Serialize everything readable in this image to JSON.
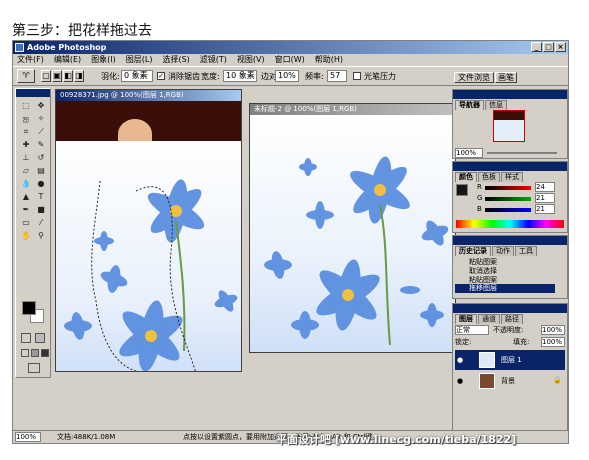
{
  "caption": "第三步：把花样拖过去",
  "app": {
    "title": "Adobe Photoshop",
    "menus": [
      "文件(F)",
      "编辑(E)",
      "图象(I)",
      "图层(L)",
      "选择(S)",
      "滤镜(T)",
      "视图(V)",
      "窗口(W)",
      "帮助(H)"
    ],
    "options": {
      "feather_label": "羽化:",
      "feather_value": "0 象素",
      "antialias_label": "消除锯齿",
      "width_label": "宽度:",
      "width_value": "10 象素",
      "contrast_label": "边对比度:",
      "contrast_value": "10%",
      "freq_label": "频率:",
      "freq_value": "57",
      "pen_pressure_label": "光笔压力",
      "tab_file_browser": "文件浏览",
      "tab_brushes": "画笔"
    }
  },
  "docs": {
    "doc1_title": "00928371.jpg @ 100%(图层 1,RGB)",
    "doc2_title": "未标题-2 @ 100%(图层 1,RGB)"
  },
  "panels": {
    "navigator_tabs": [
      "导航器",
      "信息"
    ],
    "navigator_zoom": "100%",
    "color_tabs": [
      "颜色",
      "色板",
      "样式"
    ],
    "color_values": {
      "R": "24",
      "G": "21",
      "B": "21"
    },
    "history_tabs": [
      "历史记录",
      "动作",
      "工具"
    ],
    "history_items": [
      "粘贴图案",
      "取消选择",
      "粘贴图案",
      "拖移图层"
    ],
    "layers_tabs": [
      "图层",
      "通道",
      "路径"
    ],
    "blend_mode": "正常",
    "opacity_label": "不透明度:",
    "opacity_value": "100%",
    "lock_label": "锁定:",
    "fill_label": "填充:",
    "fill_value": "100%",
    "layers": [
      "图层 1",
      "背景"
    ]
  },
  "status": {
    "zoom": "100%",
    "doc_size": "文档:488K/1.08M",
    "hint": "点按以设置紫圆点，要用附加选项，使用Shift、Alt 和 Ctrl键。"
  },
  "watermark": "平面设计吧 [www.linecg.com/tieba/1822]",
  "colors": {
    "title_blue": "#0a246a",
    "ui_gray": "#d4d0c8",
    "flower_blue": "#5b8fe0"
  }
}
